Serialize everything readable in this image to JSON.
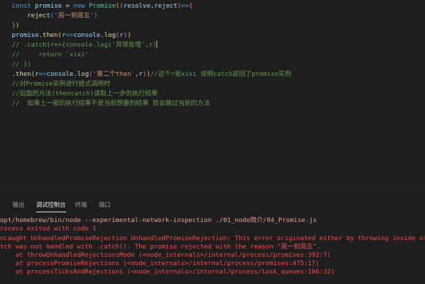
{
  "editor": {
    "lines": [
      {
        "tokens": [
          {
            "t": "const ",
            "c": "kw"
          },
          {
            "t": "promise",
            "c": "var"
          },
          {
            "t": " = ",
            "c": "pn"
          },
          {
            "t": "new ",
            "c": "kw"
          },
          {
            "t": "Promise",
            "c": "cls"
          },
          {
            "t": "(",
            "c": "br1"
          },
          {
            "t": "(",
            "c": "br2"
          },
          {
            "t": "resolve",
            "c": "var"
          },
          {
            "t": ",",
            "c": "pn"
          },
          {
            "t": "reject",
            "c": "var"
          },
          {
            "t": ")",
            "c": "br2"
          },
          {
            "t": "=>",
            "c": "kw"
          },
          {
            "t": "{",
            "c": "br2"
          }
        ]
      },
      {
        "tokens": [
          {
            "t": "    ",
            "c": "pn"
          },
          {
            "t": "reject",
            "c": "fn"
          },
          {
            "t": "(",
            "c": "br3"
          },
          {
            "t": "'周一到周五'",
            "c": "str"
          },
          {
            "t": ")",
            "c": "br3"
          }
        ]
      },
      {
        "tokens": [
          {
            "t": "}",
            "c": "br2"
          },
          {
            "t": ")",
            "c": "br1"
          }
        ]
      },
      {
        "tokens": [
          {
            "t": "promise",
            "c": "var"
          },
          {
            "t": ".",
            "c": "pn"
          },
          {
            "t": "then",
            "c": "fn"
          },
          {
            "t": "(",
            "c": "br1"
          },
          {
            "t": "r",
            "c": "var"
          },
          {
            "t": "=>",
            "c": "kw"
          },
          {
            "t": "console",
            "c": "var"
          },
          {
            "t": ".",
            "c": "pn"
          },
          {
            "t": "log",
            "c": "fn"
          },
          {
            "t": "(",
            "c": "br2"
          },
          {
            "t": "r",
            "c": "var"
          },
          {
            "t": ")",
            "c": "br2"
          },
          {
            "t": ")",
            "c": "br1"
          }
        ]
      },
      {
        "tokens": [
          {
            "t": "// .catch(r=>{console.log('异常处理',r)",
            "c": "cm"
          },
          {
            "t": "",
            "c": "cursor"
          }
        ]
      },
      {
        "tokens": [
          {
            "t": "//     return 'xixi'",
            "c": "cm"
          }
        ]
      },
      {
        "tokens": [
          {
            "t": "// })",
            "c": "cm"
          }
        ]
      },
      {
        "tokens": [
          {
            "t": ".",
            "c": "pn"
          },
          {
            "t": "then",
            "c": "fn"
          },
          {
            "t": "(",
            "c": "br1"
          },
          {
            "t": "r",
            "c": "var"
          },
          {
            "t": "=>",
            "c": "kw"
          },
          {
            "t": "console",
            "c": "var"
          },
          {
            "t": ".",
            "c": "pn"
          },
          {
            "t": "log",
            "c": "fn"
          },
          {
            "t": "(",
            "c": "br2"
          },
          {
            "t": "'第二个then'",
            "c": "str"
          },
          {
            "t": ",",
            "c": "pn"
          },
          {
            "t": "r",
            "c": "var"
          },
          {
            "t": ")",
            "c": "br2"
          },
          {
            "t": ")",
            "c": "br1"
          },
          {
            "t": "//这个r是xixi 说明catch返回了promise实例",
            "c": "cm"
          }
        ]
      },
      {
        "tokens": [
          {
            "t": "//对Promise实例进行链式调用时",
            "c": "cm"
          }
        ]
      },
      {
        "tokens": [
          {
            "t": "//后面的方法(thencatch)读取上一步的执行结果",
            "c": "cm"
          }
        ]
      },
      {
        "tokens": [
          {
            "t": "//  如果上一部的执行结果不是当前想要的结果 就会跳过当前的方法",
            "c": "cm"
          }
        ]
      }
    ]
  },
  "panel": {
    "tabs": [
      {
        "label": "输出",
        "active": false
      },
      {
        "label": "调试控制台",
        "active": true
      },
      {
        "label": "终端",
        "active": false
      },
      {
        "label": "端口",
        "active": false
      }
    ],
    "output": [
      {
        "text": "opt/homebrew/bin/node --experimental-network-inspection ./01_node简介/04_Promise.js",
        "kind": "cmd"
      },
      {
        "text": "rocess exited with code 1",
        "kind": "err"
      },
      {
        "text": "ncaught UnhandledPromiseRejection UnhandledPromiseRejection: This error originated either by throwing inside of an a",
        "kind": "err"
      },
      {
        "text": "tch was not handled with .catch(). The promise rejected with the reason \"周一到周五\".",
        "kind": "err"
      },
      {
        "text": "    at throwUnhandledRejectionsMode (<node_internals>/internal/process/promises:392:7)",
        "kind": "err"
      },
      {
        "text": "    at processPromiseRejections (<node_internals>/internal/process/promises:475:17)",
        "kind": "err"
      },
      {
        "text": "    at processTicksAndRejections (<node_internals>/internal/process/task_queues:106:32)",
        "kind": "err"
      }
    ]
  },
  "colors": {
    "background": "#1e1e1e",
    "keyword": "#569cd6",
    "variable": "#9cdcfe",
    "class": "#4ec9b0",
    "function": "#dcdcaa",
    "string": "#ce9178",
    "comment": "#6a9955",
    "error": "#f14c4c"
  }
}
